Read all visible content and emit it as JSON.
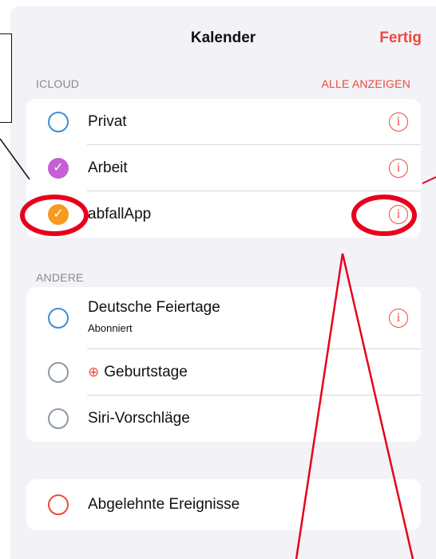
{
  "header": {
    "title": "Kalender",
    "done_label": "Fertig"
  },
  "icloud": {
    "label": "ICLOUD",
    "action": "ALLE ANZEIGEN",
    "items": [
      {
        "name": "Privat",
        "checked": false,
        "color": "#3a8fd8"
      },
      {
        "name": "Arbeit",
        "checked": true,
        "color": "#c45fd6"
      },
      {
        "name": "abfallApp",
        "checked": true,
        "color": "#f79a1f"
      }
    ]
  },
  "other": {
    "label": "ANDERE",
    "items": [
      {
        "name": "Deutsche Feiertage",
        "subtitle": "Abonniert"
      },
      {
        "name": "Geburtstage"
      },
      {
        "name": "Siri-Vorschläge"
      }
    ]
  },
  "declined": {
    "name": "Abgelehnte Ereignisse"
  },
  "icons": {
    "info": "i",
    "check": "✓",
    "gift": "⊕"
  },
  "colors": {
    "accent": "#f0483e",
    "annotation": "#e8001c"
  }
}
